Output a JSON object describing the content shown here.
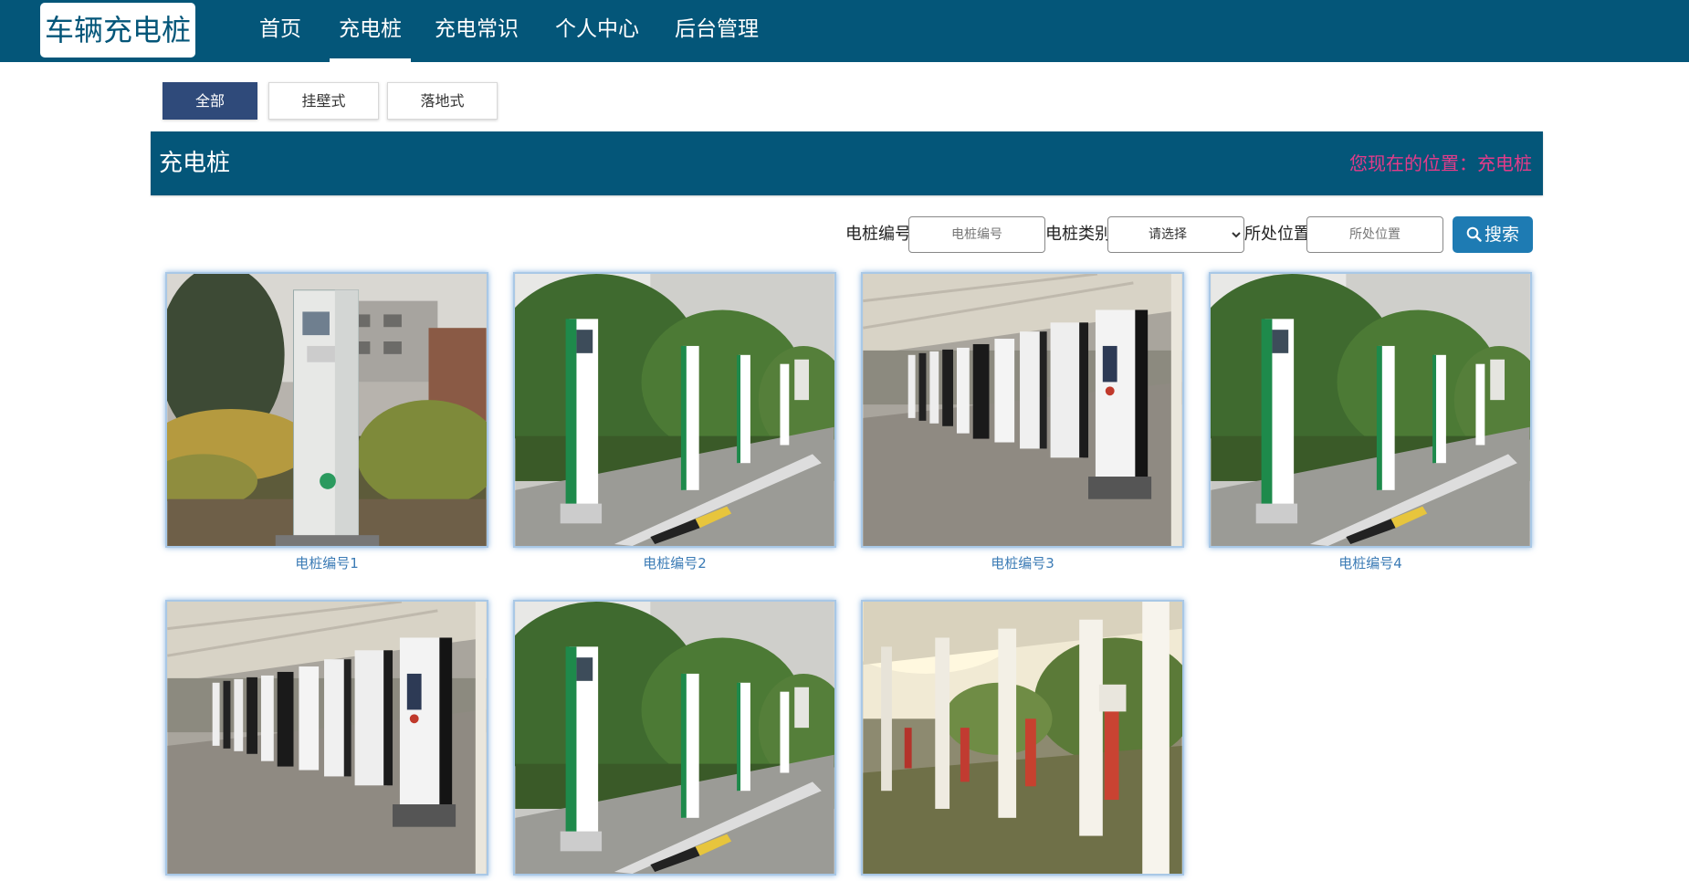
{
  "brand": "车辆充电桩",
  "nav": {
    "items": [
      {
        "label": "首页",
        "active": false
      },
      {
        "label": "充电桩",
        "active": true
      },
      {
        "label": "充电常识",
        "active": false
      },
      {
        "label": "个人中心",
        "active": false
      },
      {
        "label": "后台管理",
        "active": false
      }
    ]
  },
  "filter_tabs": [
    {
      "label": "全部",
      "active": true
    },
    {
      "label": "挂壁式",
      "active": false
    },
    {
      "label": "落地式",
      "active": false
    }
  ],
  "section": {
    "title": "充电桩",
    "breadcrumb": "您现在的位置：充电桩"
  },
  "search": {
    "pile_no_label": "电桩编号",
    "pile_no_placeholder": "电桩编号",
    "pile_no_value": "",
    "type_label": "电桩类别",
    "type_selected": "请选择",
    "location_label": "所处位置",
    "location_placeholder": "所处位置",
    "location_value": "",
    "button_label": "搜索",
    "button_icon": "search-icon"
  },
  "cards": [
    {
      "caption": "电桩编号1",
      "photo": "single-charging-post-in-garden"
    },
    {
      "caption": "电桩编号2",
      "photo": "green-charging-posts-roadside"
    },
    {
      "caption": "电桩编号3",
      "photo": "dc-charging-posts-under-canopy"
    },
    {
      "caption": "电桩编号4",
      "photo": "green-charging-posts-roadside"
    },
    {
      "caption": "",
      "photo": "dc-charging-posts-under-canopy"
    },
    {
      "caption": "",
      "photo": "green-charging-posts-roadside"
    },
    {
      "caption": "",
      "photo": "red-charging-posts-in-carport"
    }
  ],
  "colors": {
    "primary": "#045679",
    "active_tab": "#2f4a7a",
    "breadcrumb": "#e33b8a",
    "search_button": "#1e7bb3",
    "caption": "#3b7bb5"
  }
}
